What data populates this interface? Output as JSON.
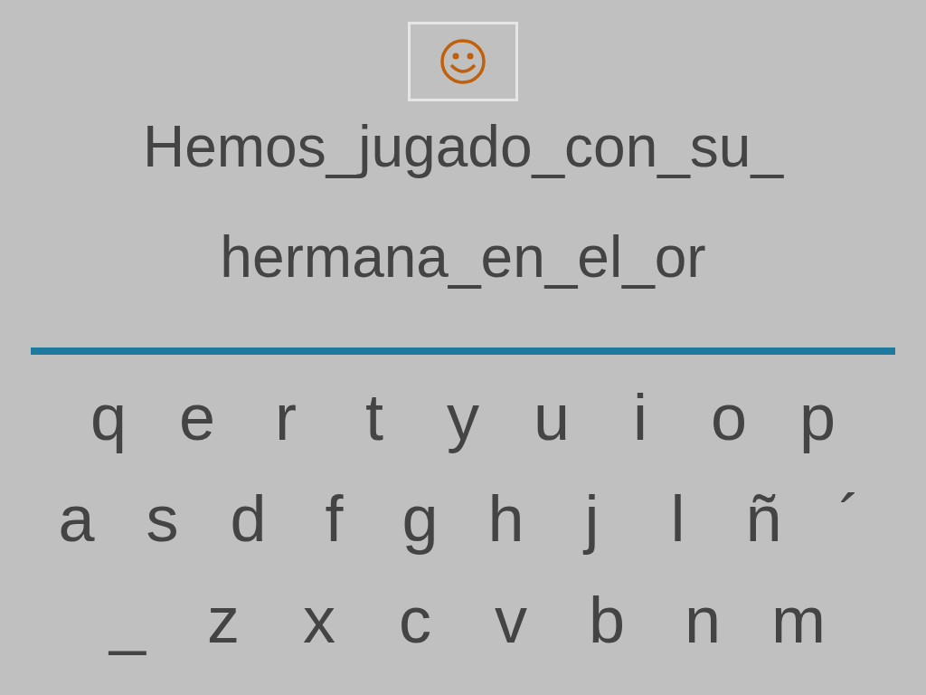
{
  "feedback": {
    "kind": "smiley"
  },
  "sentence_lines": [
    "Hemos_jugado_con_su_",
    "hermana_en_el_or"
  ],
  "keyboard_rows": [
    [
      "q",
      "e",
      "r",
      "t",
      "y",
      "u",
      "i",
      "o",
      "p"
    ],
    [
      "a",
      "s",
      "d",
      "f",
      "g",
      "h",
      "j",
      "l",
      "ñ",
      "´"
    ],
    [
      "_",
      "z",
      "x",
      "c",
      "v",
      "b",
      "n",
      "m"
    ]
  ]
}
